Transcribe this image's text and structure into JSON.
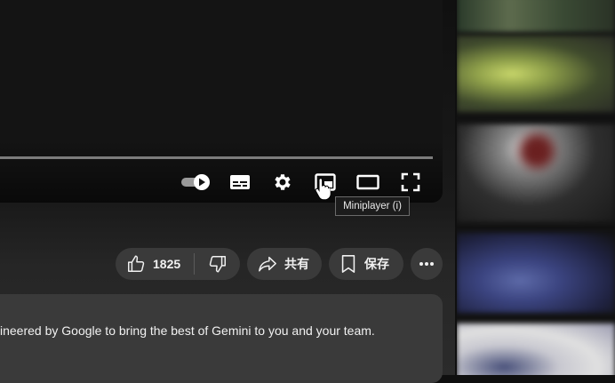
{
  "player": {
    "tooltip": "Miniplayer (i)",
    "controls": [
      {
        "name": "autoplay-toggle"
      },
      {
        "name": "subtitles-icon"
      },
      {
        "name": "settings-icon"
      },
      {
        "name": "miniplayer-icon"
      },
      {
        "name": "theater-mode-icon"
      },
      {
        "name": "fullscreen-icon"
      }
    ]
  },
  "actions": {
    "like_count": "1825",
    "share_label": "共有",
    "save_label": "保存"
  },
  "description": {
    "snippet": "ineered by Google to bring the best of Gemini to you and your team."
  },
  "colors": {
    "background": "#0f0f0f",
    "pill": "#3a3a3a",
    "text": "#f1f1f1"
  }
}
